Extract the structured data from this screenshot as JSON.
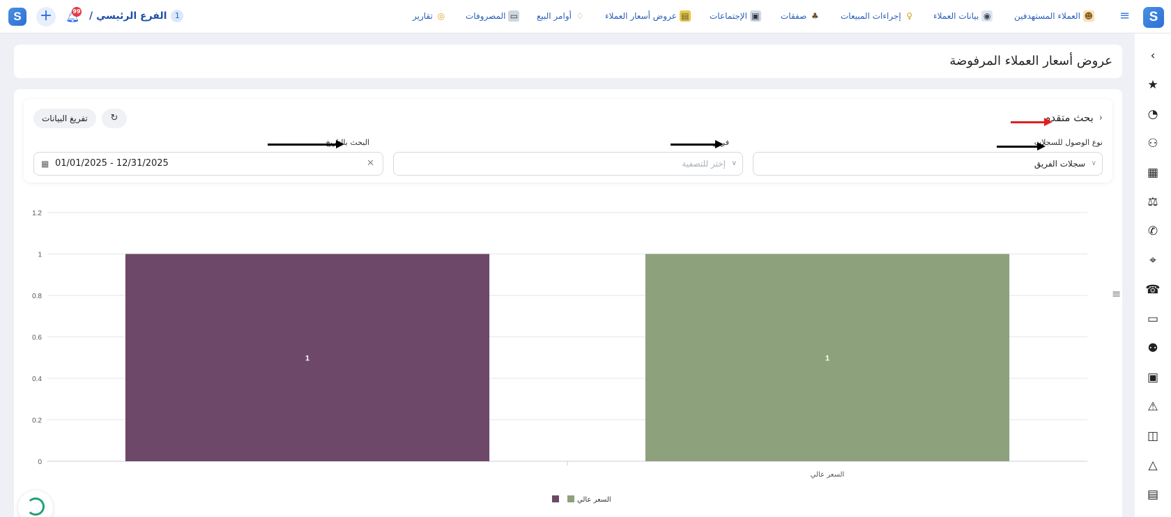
{
  "topbar": {
    "branch_label": "الفرع الرئيسي /",
    "branch_count": "1",
    "notification_count": "99",
    "nav": [
      {
        "label": "العملاء المستهدفين",
        "icon": "target-customers-icon"
      },
      {
        "label": "بيانات العملاء",
        "icon": "customer-data-icon"
      },
      {
        "label": "إجراءات المبيعات",
        "icon": "sales-actions-icon"
      },
      {
        "label": "صفقات",
        "icon": "deals-icon"
      },
      {
        "label": "الإجتماعات",
        "icon": "meetings-icon"
      },
      {
        "label": "عروض أسعار العملاء",
        "icon": "quotes-icon"
      },
      {
        "label": "أوامر البيع",
        "icon": "sales-orders-icon"
      },
      {
        "label": "المصروفات",
        "icon": "expenses-icon"
      },
      {
        "label": "تقارير",
        "icon": "reports-icon"
      }
    ]
  },
  "page": {
    "title": "عروض أسعار العملاء المرفوضة"
  },
  "filters": {
    "advanced_search": "بحث متقدم",
    "clear_button": "تفريغ البيانات",
    "access_type_label": "نوع الوصول للسجلات",
    "access_type_value": "سجلات الفريق",
    "team_label": "فريق",
    "team_placeholder": "إختر للتصفية",
    "date_label": "البحث بالتاريخ",
    "date_value": "01/01/2025 - 12/31/2025"
  },
  "chart_data": {
    "type": "bar",
    "categories": [
      "السعر عالي"
    ],
    "series": [
      {
        "name": "السعر عالي",
        "values": [
          1
        ],
        "color": "#8da17d"
      },
      {
        "name": "",
        "values": [
          1
        ],
        "color": "#6e4868"
      }
    ],
    "ylim": [
      0,
      1.2
    ],
    "yticks": [
      "0",
      "0.2",
      "0.4",
      "0.6",
      "0.8",
      "1",
      "1.2"
    ],
    "data_labels": [
      "1",
      "1"
    ],
    "legend": [
      {
        "label": "السعر عالي",
        "color": "#8da17d"
      },
      {
        "label": "",
        "color": "#6e4868"
      }
    ],
    "legend_position": "bottom-center",
    "grid": true
  },
  "colors": {
    "accent": "#2b6ee0",
    "annotation_red": "#e02020",
    "annotation_black": "#000000"
  }
}
